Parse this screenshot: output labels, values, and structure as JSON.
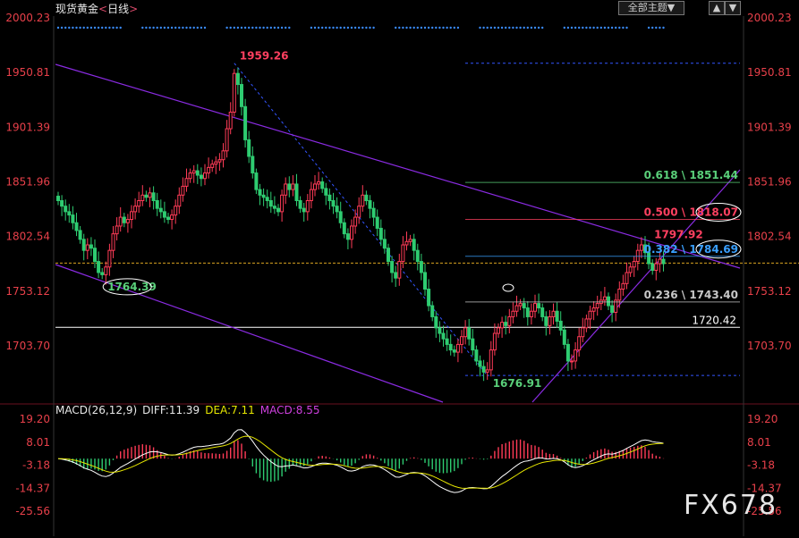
{
  "header": {
    "instrument": "现货黄金",
    "period_open": "<",
    "period": "日线",
    "period_close": ">",
    "theme_button": "全部主题",
    "theme_arrow": "▼",
    "nav_up": "▲",
    "nav_down": "▼"
  },
  "macd_header": {
    "title": "MACD(26,12,9)",
    "diff": "DIFF:11.39",
    "dea": "DEA:7.11",
    "macd": "MACD:8.55"
  },
  "watermark": "FX678",
  "colors": {
    "background": "#000000",
    "up_candle": "#ff3b57",
    "down_candle": "#2ecc71",
    "axis_label": "#e8404a",
    "trend_line": "#8a2be2",
    "fib_line": "#3355ff",
    "fib_0618": "#3a8a3a",
    "fib_0500": "#b03050",
    "diff_line": "#ffffff",
    "dea_line": "#e6e600",
    "dashed_guide": "#3355ff",
    "current_price": "#d9a520"
  },
  "chart_data": {
    "type": "candlestick",
    "price_axis": {
      "ticks": [
        2000.23,
        1950.81,
        1901.39,
        1851.96,
        1802.54,
        1753.12,
        1703.7
      ],
      "tick_labels": [
        "2000.23",
        "1950.81",
        "1901.39",
        "1851.96",
        "1802.54",
        "1753.12",
        "1703.70"
      ],
      "range": [
        1670,
        2005
      ]
    },
    "macd_axis": {
      "ticks": [
        19.2,
        8.01,
        -3.18,
        -14.37,
        -25.56
      ],
      "tick_labels": [
        "19.20",
        "8.01",
        "-3.18",
        "-14.37",
        "-25.56"
      ],
      "range": [
        -30,
        22
      ]
    },
    "annotations": [
      {
        "label": "1959.26",
        "bar": 48,
        "price": 1959.26,
        "kind": "high",
        "color": "#ff4060"
      },
      {
        "label": "1764.39",
        "bar": 12,
        "price": 1764.39,
        "kind": "low",
        "color": "#5ad07a",
        "circled": true
      },
      {
        "label": "1676.91",
        "bar": 117,
        "price": 1676.91,
        "kind": "low",
        "color": "#5ad07a"
      },
      {
        "label": "1797.92",
        "bar": 161,
        "price": 1797.92,
        "kind": "high",
        "color": "#ff4060"
      }
    ],
    "fibonacci": [
      {
        "label": "0.618 \\ 1851.44",
        "level": 1851.44,
        "color": "#5ad07a"
      },
      {
        "label": "0.500 \\ 1818.07",
        "level": 1818.07,
        "color": "#ff4060",
        "circled": true
      },
      {
        "label": "0.382 \\ 1784.69",
        "level": 1784.69,
        "color": "#3aa0ff",
        "circled": true
      },
      {
        "label": "0.236 \\ 1743.40",
        "level": 1743.4,
        "color": "#c8c8c8"
      }
    ],
    "fib_top": 1959.26,
    "fib_bottom": 1676.91,
    "support_line": {
      "label": "1720.42",
      "level": 1720.42
    },
    "current_price": 1778.5,
    "closes": [
      1835,
      1830,
      1825,
      1822,
      1815,
      1808,
      1800,
      1790,
      1795,
      1792,
      1780,
      1770,
      1768,
      1775,
      1790,
      1805,
      1812,
      1820,
      1815,
      1818,
      1825,
      1830,
      1835,
      1840,
      1838,
      1842,
      1835,
      1828,
      1825,
      1820,
      1818,
      1822,
      1830,
      1840,
      1848,
      1855,
      1860,
      1862,
      1858,
      1855,
      1860,
      1865,
      1868,
      1870,
      1872,
      1880,
      1900,
      1915,
      1950,
      1940,
      1920,
      1890,
      1875,
      1860,
      1845,
      1840,
      1838,
      1835,
      1830,
      1828,
      1825,
      1840,
      1850,
      1845,
      1850,
      1835,
      1828,
      1825,
      1835,
      1845,
      1850,
      1852,
      1846,
      1840,
      1835,
      1830,
      1825,
      1815,
      1805,
      1800,
      1812,
      1820,
      1830,
      1840,
      1835,
      1828,
      1820,
      1810,
      1800,
      1792,
      1780,
      1770,
      1765,
      1780,
      1795,
      1798,
      1800,
      1790,
      1780,
      1770,
      1755,
      1740,
      1730,
      1720,
      1715,
      1710,
      1705,
      1700,
      1698,
      1705,
      1712,
      1720,
      1710,
      1700,
      1690,
      1685,
      1680,
      1682,
      1700,
      1715,
      1720,
      1725,
      1722,
      1730,
      1735,
      1740,
      1742,
      1738,
      1730,
      1735,
      1742,
      1738,
      1730,
      1722,
      1730,
      1735,
      1726,
      1718,
      1705,
      1690,
      1690,
      1700,
      1712,
      1720,
      1728,
      1735,
      1738,
      1742,
      1745,
      1748,
      1740,
      1734,
      1745,
      1755,
      1760,
      1770,
      1775,
      1780,
      1790,
      1795,
      1788,
      1778,
      1772,
      1778,
      1782,
      1778
    ]
  }
}
